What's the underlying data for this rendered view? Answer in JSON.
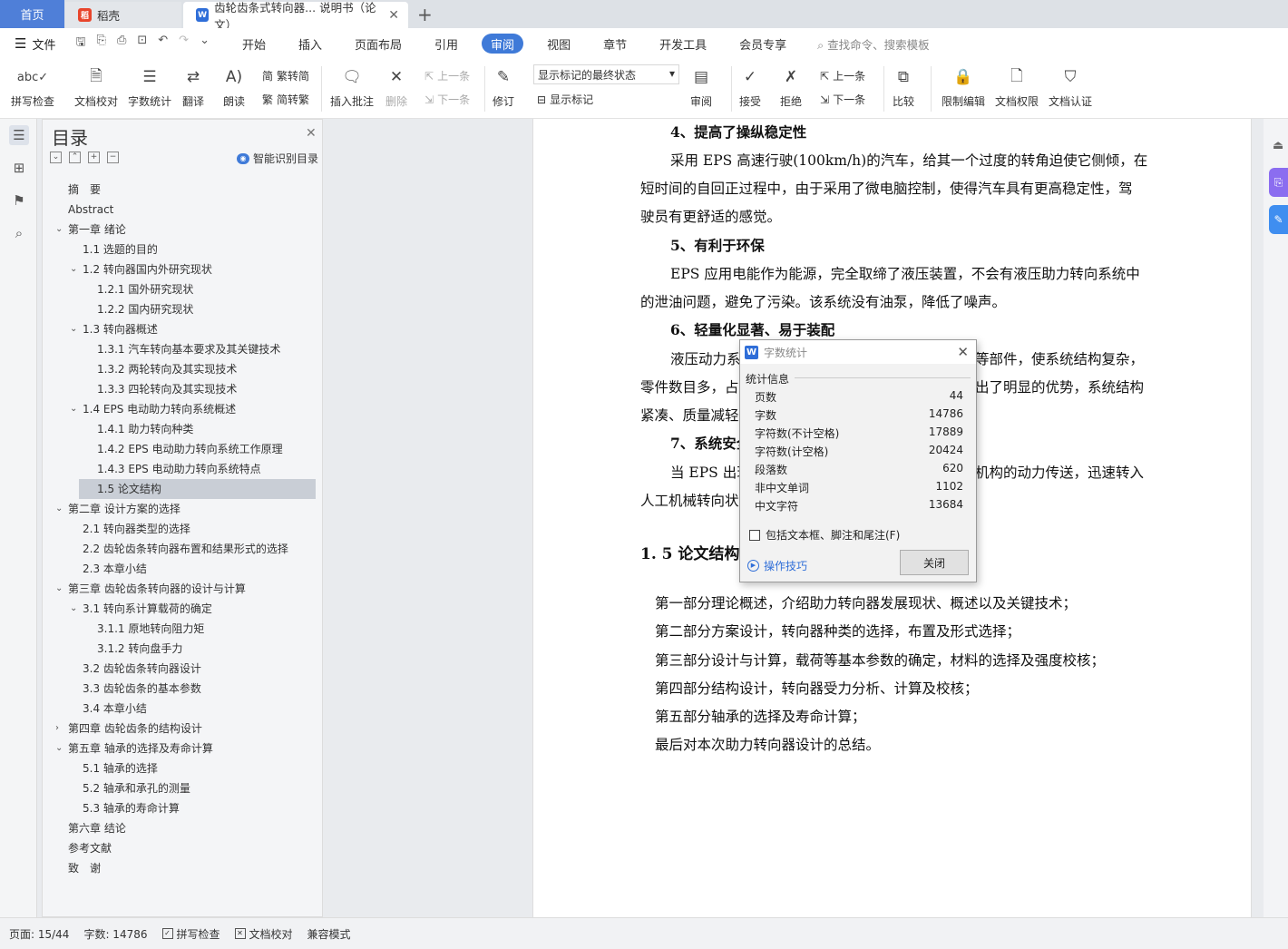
{
  "tabs": {
    "home": "首页",
    "daoke": "稻壳",
    "doc": "齿轮齿条式转向器... 说明书（论文）"
  },
  "menubar": {
    "file": "文件",
    "menus": [
      "开始",
      "插入",
      "页面布局",
      "引用",
      "审阅",
      "视图",
      "章节",
      "开发工具",
      "会员专享"
    ],
    "active": "审阅",
    "search_placeholder": "查找命令、搜索模板"
  },
  "ribbon": {
    "spell": "拼写检查",
    "proof": "文档校对",
    "wordcount": "字数统计",
    "translate": "翻译",
    "read": "朗读",
    "trad": "繁转简",
    "simp": "简转繁",
    "insert_comment": "插入批注",
    "delete": "删除",
    "prev_comment": "上一条",
    "next_comment": "下一条",
    "revise": "修订",
    "markup_state": "显示标记的最终状态",
    "show_markup": "显示标记",
    "review": "审阅",
    "accept": "接受",
    "reject": "拒绝",
    "prev_change": "上一条",
    "next_change": "下一条",
    "compare": "比较",
    "restrict": "限制编辑",
    "perm": "文档权限",
    "auth": "文档认证"
  },
  "toc": {
    "title": "目录",
    "smart": "智能识别目录",
    "items": [
      {
        "label": "摘　要",
        "level": 0,
        "arrow": ""
      },
      {
        "label": "Abstract",
        "level": 0,
        "arrow": ""
      },
      {
        "label": "第一章  绪论",
        "level": 0,
        "arrow": "v"
      },
      {
        "label": "1.1 选题的目的",
        "level": 1,
        "arrow": ""
      },
      {
        "label": "1.2 转向器国内外研究现状",
        "level": 1,
        "arrow": "v"
      },
      {
        "label": "1.2.1 国外研究现状",
        "level": 2,
        "arrow": ""
      },
      {
        "label": "1.2.2 国内研究现状",
        "level": 2,
        "arrow": ""
      },
      {
        "label": "1.3 转向器概述",
        "level": 1,
        "arrow": "v"
      },
      {
        "label": "1.3.1 汽车转向基本要求及其关键技术",
        "level": 2,
        "arrow": ""
      },
      {
        "label": "1.3.2 两轮转向及其实现技术",
        "level": 2,
        "arrow": ""
      },
      {
        "label": "1.3.3 四轮转向及其实现技术",
        "level": 2,
        "arrow": ""
      },
      {
        "label": "1.4 EPS 电动助力转向系统概述",
        "level": 1,
        "arrow": "v"
      },
      {
        "label": "1.4.1 助力转向种类",
        "level": 2,
        "arrow": ""
      },
      {
        "label": "1.4.2 EPS 电动助力转向系统工作原理",
        "level": 2,
        "arrow": ""
      },
      {
        "label": "1.4.3 EPS 电动助力转向系统特点",
        "level": 2,
        "arrow": ""
      },
      {
        "label": "1.5 论文结构",
        "level": 2,
        "arrow": "",
        "selected": true
      },
      {
        "label": "第二章  设计方案的选择",
        "level": 0,
        "arrow": "v"
      },
      {
        "label": "2.1  转向器类型的选择",
        "level": 1,
        "arrow": ""
      },
      {
        "label": "2.2  齿轮齿条转向器布置和结果形式的选择",
        "level": 1,
        "arrow": ""
      },
      {
        "label": "2.3 本章小结",
        "level": 1,
        "arrow": ""
      },
      {
        "label": "第三章  齿轮齿条转向器的设计与计算",
        "level": 0,
        "arrow": "v"
      },
      {
        "label": "3.1 转向系计算载荷的确定",
        "level": 1,
        "arrow": "v"
      },
      {
        "label": "3.1.1 原地转向阻力矩",
        "level": 2,
        "arrow": ""
      },
      {
        "label": "3.1.2 转向盘手力",
        "level": 2,
        "arrow": ""
      },
      {
        "label": "3.2 齿轮齿条转向器设计",
        "level": 1,
        "arrow": ""
      },
      {
        "label": "3.3 齿轮齿条的基本参数",
        "level": 1,
        "arrow": ""
      },
      {
        "label": "3.4 本章小结",
        "level": 1,
        "arrow": ""
      },
      {
        "label": "第四章  齿轮齿条的结构设计",
        "level": 0,
        "arrow": ">"
      },
      {
        "label": "第五章  轴承的选择及寿命计算",
        "level": 0,
        "arrow": "v"
      },
      {
        "label": "5.1 轴承的选择",
        "level": 1,
        "arrow": ""
      },
      {
        "label": "5.2 轴承和承孔的测量",
        "level": 1,
        "arrow": ""
      },
      {
        "label": "5.3 轴承的寿命计算",
        "level": 1,
        "arrow": ""
      },
      {
        "label": "第六章  结论",
        "level": 0,
        "arrow": ""
      },
      {
        "label": "参考文献",
        "level": 0,
        "arrow": ""
      },
      {
        "label": "致　谢",
        "level": 0,
        "arrow": ""
      }
    ]
  },
  "doc": {
    "h4": "4、提高了操纵稳定性",
    "p4a": "采用 EPS 高速行驶(100km/h)的汽车，给其一个过度的转角迫使它侧倾，在",
    "p4b": "短时间的自回正过程中，由于采用了微电脑控制，使得汽车具有更高稳定性，驾",
    "p4c": "驶员有更舒适的感觉。",
    "h5": "5、有利于环保",
    "p5a": "EPS 应用电能作为能源，完全取缔了液压装置，不会有液压助力转向系统中",
    "p5b": "的泄油问题，避免了污染。该系统没有油泵，降低了噪声。",
    "h6": "6、轻量化显著、易于装配",
    "p6a_left": "液压动力系",
    "p6a_right": "等部件，使系统结构复杂，",
    "p6b_left": "零件数目多，占",
    "p6b_right": "出了明显的优势，系统结构",
    "p6c_left": "紧凑、质量减轻",
    "h7_left": "7、系统安全",
    "p7a_left": "当 EPS 出现",
    "p7a_right": "机构的动力传送，迅速转入",
    "p7b_left": "人工机械转向状",
    "section": "1. 5 论文结构",
    "l1": "第一部分理论概述，介绍助力转向器发展现状、概述以及关键技术；",
    "l2": "第二部分方案设计，转向器种类的选择，布置及形式选择；",
    "l3": "第三部分设计与计算，载荷等基本参数的确定，材料的选择及强度校核；",
    "l4": "第四部分结构设计，转向器受力分析、计算及校核；",
    "l5": "第五部分轴承的选择及寿命计算；",
    "l6": "最后对本次助力转向器设计的总结。"
  },
  "dialog": {
    "title": "字数统计",
    "group": "统计信息",
    "rows": [
      {
        "label": "页数",
        "value": "44"
      },
      {
        "label": "字数",
        "value": "14786"
      },
      {
        "label": "字符数(不计空格)",
        "value": "17889"
      },
      {
        "label": "字符数(计空格)",
        "value": "20424"
      },
      {
        "label": "段落数",
        "value": "620"
      },
      {
        "label": "非中文单词",
        "value": "1102"
      },
      {
        "label": "中文字符",
        "value": "13684"
      }
    ],
    "checkbox": "包括文本框、脚注和尾注(F)",
    "tips": "操作技巧",
    "close": "关闭"
  },
  "status": {
    "page": "页面: 15/44",
    "words": "字数: 14786",
    "spell": "拼写检查",
    "proof": "文档校对",
    "compat": "兼容模式"
  },
  "colors": {
    "accent": "#3f7ad8",
    "home_tab": "#4f7fd8",
    "selected_toc": "#c9ced6"
  }
}
